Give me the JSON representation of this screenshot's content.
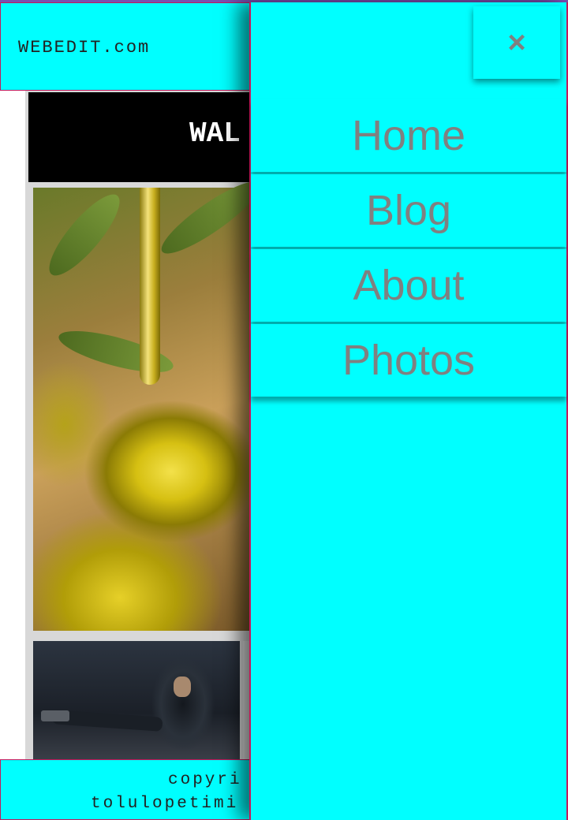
{
  "header": {
    "brand": "WEBEDIT.com"
  },
  "main": {
    "banner_title": "WAL",
    "images": [
      {
        "name": "olive-oil-photo",
        "alt": "olive oil"
      },
      {
        "name": "hooded-figure-photo",
        "alt": "hooded figure"
      }
    ]
  },
  "footer": {
    "line1": "copyri",
    "line2": "tolulopetimi"
  },
  "menu": {
    "close_icon": "×",
    "items": [
      {
        "label": "Home"
      },
      {
        "label": "Blog"
      },
      {
        "label": "About"
      },
      {
        "label": "Photos"
      }
    ]
  },
  "colors": {
    "accent": "#00ffff",
    "border": "#c2185b",
    "menu_text": "#808080"
  }
}
